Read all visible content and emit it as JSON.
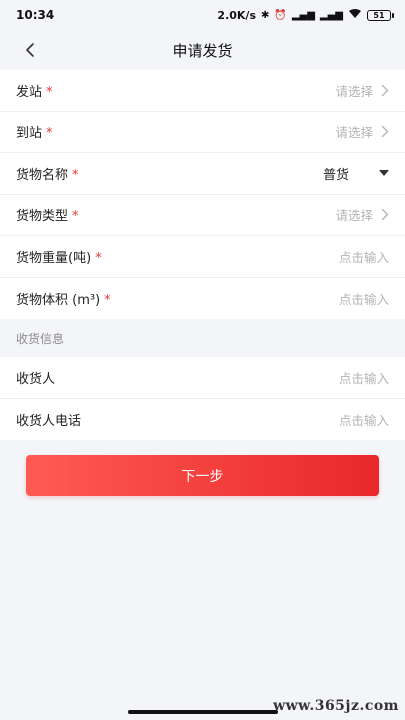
{
  "status_bar": {
    "time": "10:34",
    "speed": "2.0K/s",
    "battery": "51"
  },
  "nav": {
    "title": "申请发货"
  },
  "form": {
    "rows": [
      {
        "label": "发站",
        "required_mark": "*",
        "value": "请选择",
        "type": "picker"
      },
      {
        "label": "到站",
        "required_mark": "*",
        "value": "请选择",
        "type": "picker"
      },
      {
        "label": "货物名称",
        "required_mark": "*",
        "value": "普货",
        "type": "dropdown"
      },
      {
        "label": "货物类型",
        "required_mark": "*",
        "value": "请选择",
        "type": "picker"
      },
      {
        "label": "货物重量(吨)",
        "required_mark": "*",
        "placeholder": "点击输入",
        "type": "input"
      },
      {
        "label": "货物体积 (m³)",
        "required_mark": "*",
        "placeholder": "点击输入",
        "type": "input"
      }
    ]
  },
  "receiver": {
    "section_title": "收货信息",
    "rows": [
      {
        "label": "收货人",
        "placeholder": "点击输入",
        "type": "input"
      },
      {
        "label": "收货人电话",
        "placeholder": "点击输入",
        "type": "input"
      }
    ]
  },
  "actions": {
    "next_label": "下一步"
  },
  "watermark": "www.365jz.com",
  "colors": {
    "accent": "#e8282a",
    "required": "#e53935",
    "background": "#f4f5f9"
  }
}
